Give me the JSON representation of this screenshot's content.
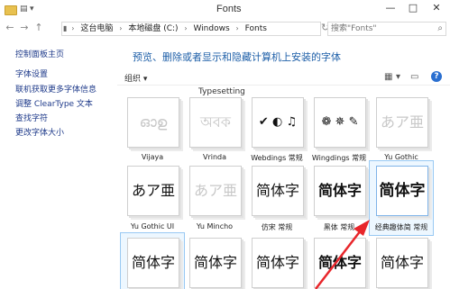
{
  "window": {
    "title": "Fonts",
    "controls": {
      "minimize": "—",
      "maximize": "□",
      "close": "✕"
    }
  },
  "address": {
    "crumbs": [
      "这台电脑",
      "本地磁盘 (C:)",
      "Windows",
      "Fonts"
    ],
    "search_placeholder": "搜索\"Fonts\""
  },
  "sidebar": {
    "items": [
      {
        "label": "控制面板主页"
      },
      {
        "label": "字体设置"
      },
      {
        "label": "联机获取更多字体信息"
      },
      {
        "label": "调整 ClearType 文本"
      },
      {
        "label": "查找字符"
      },
      {
        "label": "更改字体大小"
      }
    ]
  },
  "main": {
    "heading": "预览、删除或者显示和隐藏计算机上安装的字体",
    "organize_label": "组织 ▾",
    "partial_label": "Typesetting"
  },
  "fonts": [
    {
      "name": "Vijaya",
      "sample": "ഓഉ",
      "faded": true
    },
    {
      "name": "Vrinda",
      "sample": "অবক",
      "faded": true
    },
    {
      "name": "Webdings 常规",
      "sample": "✔ ◐ ♫",
      "faded": false
    },
    {
      "name": "Wingdings 常规",
      "sample": "❁ ✵ ✎",
      "faded": false
    },
    {
      "name": "Yu Gothic",
      "sample": "あア亜",
      "faded": true
    },
    {
      "name": "Yu Gothic UI",
      "sample": "あア亜",
      "faded": false
    },
    {
      "name": "Yu Mincho",
      "sample": "あア亜",
      "faded": true
    },
    {
      "name": "仿宋 常规",
      "sample": "简体字",
      "faded": false
    },
    {
      "name": "黑体 常规",
      "sample": "简体字",
      "faded": false
    },
    {
      "name": "经典趣体简 常规",
      "sample": "简体字",
      "faded": false
    },
    {
      "name": "",
      "sample": "简体字",
      "faded": false
    },
    {
      "name": "",
      "sample": "简体字",
      "faded": false
    },
    {
      "name": "",
      "sample": "简体字",
      "faded": false
    },
    {
      "name": "",
      "sample": "简体字",
      "faded": false
    },
    {
      "name": "",
      "sample": "简体字",
      "faded": false
    }
  ],
  "colors": {
    "accent": "#1e5fa8",
    "arrow": "#e8262b",
    "selection": "#cce8ff"
  }
}
